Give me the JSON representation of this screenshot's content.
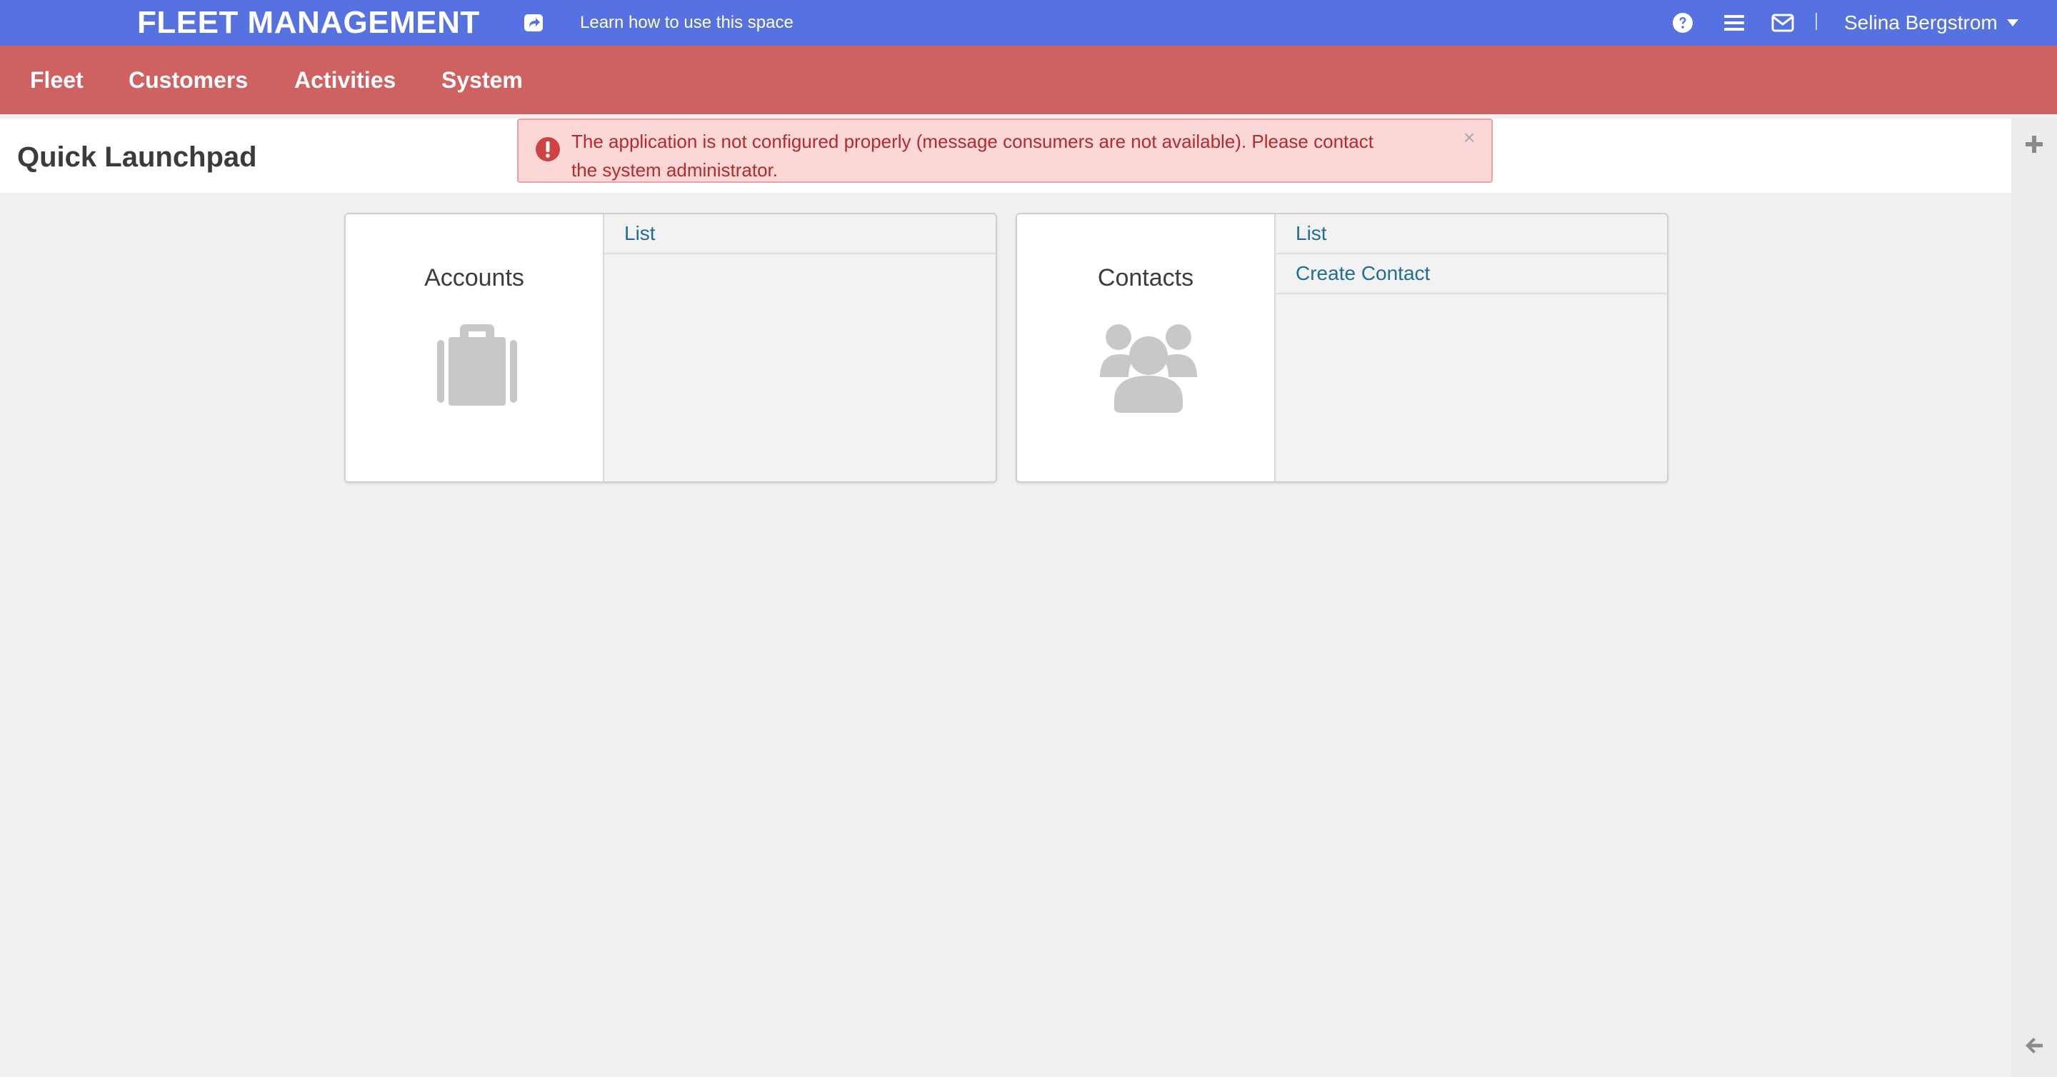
{
  "header": {
    "brand": "FLEET MANAGEMENT",
    "learn_link": "Learn how to use this space",
    "user_name": "Selina Bergstrom"
  },
  "nav": {
    "items": [
      {
        "label": "Fleet"
      },
      {
        "label": "Customers"
      },
      {
        "label": "Activities"
      },
      {
        "label": "System"
      }
    ]
  },
  "page": {
    "title": "Quick Launchpad"
  },
  "alert": {
    "message": "The application is not configured properly (message consumers are not available). Please contact the system administrator.",
    "close_symbol": "×"
  },
  "cards": [
    {
      "title": "Accounts",
      "icon": "briefcase-icon",
      "links": [
        {
          "label": "List"
        }
      ]
    },
    {
      "title": "Contacts",
      "icon": "users-icon",
      "links": [
        {
          "label": "List"
        },
        {
          "label": "Create Contact"
        }
      ]
    }
  ],
  "colors": {
    "topbar": "#5672e0",
    "navbar": "#cf6160",
    "link": "#1f6f93",
    "alert_bg": "#fcd7d7",
    "alert_text": "#b62a2a",
    "icon_gray": "#c8c8c8"
  }
}
